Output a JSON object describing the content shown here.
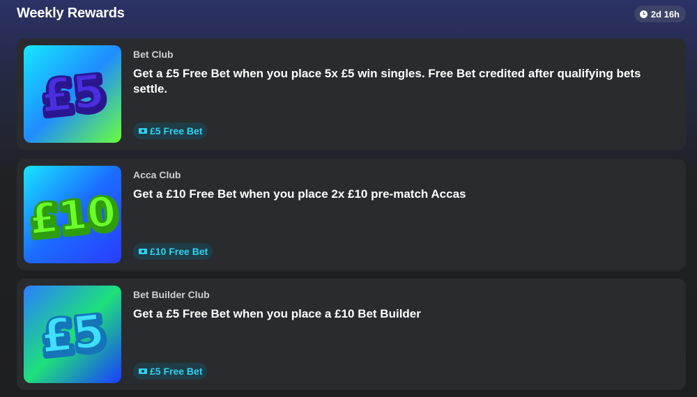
{
  "header": {
    "title": "Weekly Rewards",
    "timer": "2d 16h",
    "timer_icon": "clock-icon"
  },
  "rewards": [
    {
      "thumb_text": "£5",
      "club": "Bet Club",
      "description": "Get a £5 Free Bet when you place 5x £5 win singles. Free Bet credited after qualifying bets settle.",
      "badge": "£5 Free Bet",
      "colors": {
        "bg_from": "#16e8ff",
        "bg_mid": "#1f8cff",
        "bg_to": "#6aff3a",
        "glyph": "#4a2fe0",
        "glyph_edge": "#2a168f"
      }
    },
    {
      "thumb_text": "£10",
      "club": "Acca Club",
      "description": "Get a £10 Free Bet when you place 2x £10 pre-match Accas",
      "badge": "£10 Free Bet",
      "colors": {
        "bg_from": "#18e6ff",
        "bg_mid": "#1b6cff",
        "bg_to": "#2a3cff",
        "glyph": "#6bff2a",
        "glyph_edge": "#2e9d0e"
      }
    },
    {
      "thumb_text": "£5",
      "club": "Bet Builder Club",
      "description": "Get a £5 Free Bet when you place a £10 Bet Builder",
      "badge": "£5 Free Bet",
      "colors": {
        "bg_from": "#2a7dff",
        "bg_mid": "#1ee07a",
        "bg_to": "#1a3cff",
        "glyph": "#3fe0ff",
        "glyph_edge": "#1575b8"
      }
    }
  ],
  "badge_icon": "ticket-icon"
}
